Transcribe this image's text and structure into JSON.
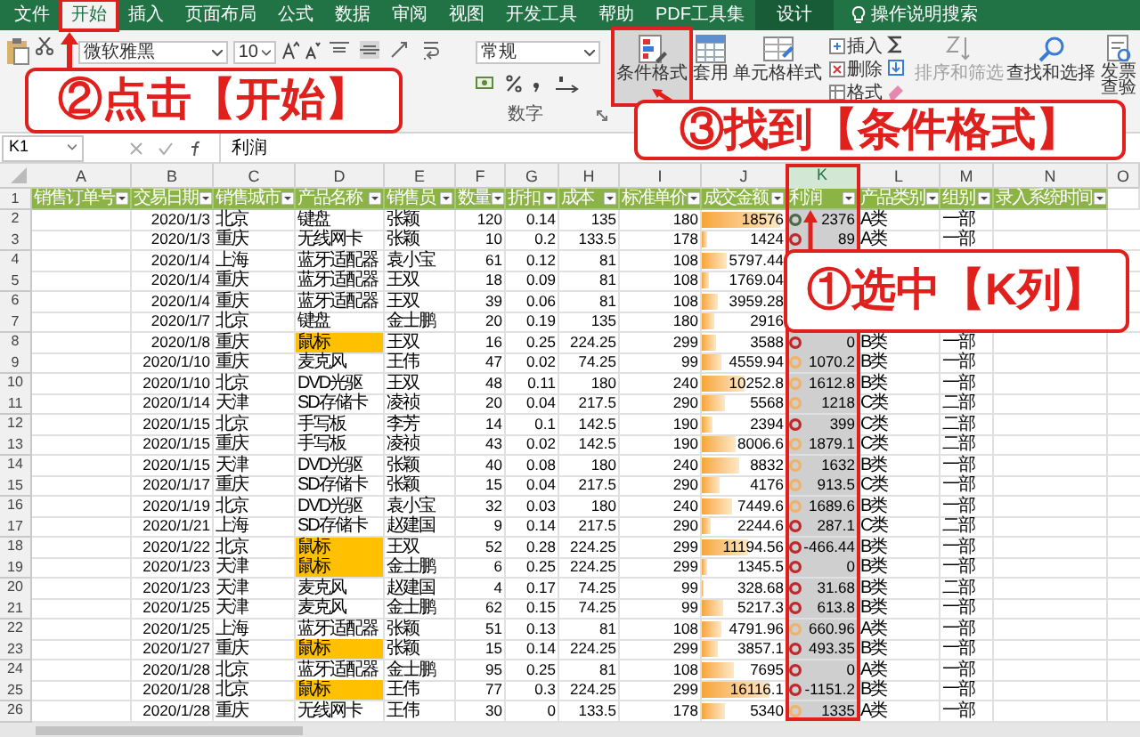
{
  "tabs": [
    {
      "label": "文件",
      "selected": false,
      "kind": "normal"
    },
    {
      "label": "开始",
      "selected": true,
      "kind": "normal"
    },
    {
      "label": "插入",
      "selected": false,
      "kind": "normal"
    },
    {
      "label": "页面布局",
      "selected": false,
      "kind": "normal"
    },
    {
      "label": "公式",
      "selected": false,
      "kind": "normal"
    },
    {
      "label": "数据",
      "selected": false,
      "kind": "normal"
    },
    {
      "label": "审阅",
      "selected": false,
      "kind": "normal"
    },
    {
      "label": "视图",
      "selected": false,
      "kind": "normal"
    },
    {
      "label": "开发工具",
      "selected": false,
      "kind": "normal"
    },
    {
      "label": "帮助",
      "selected": false,
      "kind": "normal"
    },
    {
      "label": "PDF工具集",
      "selected": false,
      "kind": "normal"
    },
    {
      "label": "设计",
      "selected": false,
      "kind": "contextual"
    }
  ],
  "search": {
    "placeholder": "操作说明搜索"
  },
  "ribbon": {
    "font_name": "微软雅黑",
    "font_size": "10",
    "number_format": "常规",
    "number_group_label": "数字",
    "styles": [
      {
        "label": "条件格式",
        "selected": true
      },
      {
        "label": "套用",
        "selected": false
      },
      {
        "label": "单元格样式",
        "selected": false
      }
    ],
    "cells": [
      "插入",
      "删除",
      "格式"
    ],
    "editing": [
      {
        "label": "排序和筛选",
        "disabled": true
      },
      {
        "label": "查找和选择",
        "disabled": false
      }
    ],
    "invoice": [
      "发票",
      "查验"
    ]
  },
  "formula_bar": {
    "name_box": "K1",
    "value": "利润"
  },
  "columns": [
    {
      "label": "A",
      "selected": false
    },
    {
      "label": "B",
      "selected": false
    },
    {
      "label": "C",
      "selected": false
    },
    {
      "label": "D",
      "selected": false
    },
    {
      "label": "E",
      "selected": false
    },
    {
      "label": "F",
      "selected": false
    },
    {
      "label": "G",
      "selected": false
    },
    {
      "label": "H",
      "selected": false
    },
    {
      "label": "I",
      "selected": false
    },
    {
      "label": "J",
      "selected": false
    },
    {
      "label": "K",
      "selected": true
    },
    {
      "label": "L",
      "selected": false
    },
    {
      "label": "M",
      "selected": false
    },
    {
      "label": "N",
      "selected": false
    },
    {
      "label": "O",
      "selected": false
    }
  ],
  "header_row_number": "1",
  "headers": [
    "销售订单号",
    "交易日期",
    "销售城市",
    "产品名称",
    "销售员",
    "数量",
    "折扣",
    "成本",
    "标准单价",
    "成交金额",
    "利润",
    "产品类别",
    "组别",
    "录入系统时间"
  ],
  "rows": [
    {
      "n": "2",
      "cells": [
        "2020/1/3",
        "北京",
        "键盘",
        "张颖",
        "120",
        "0.14",
        "135",
        "180",
        "18576",
        "2376",
        "A类",
        "一部"
      ],
      "product_highlight": false,
      "level": 0.93,
      "color": "#4a6a4a"
    },
    {
      "n": "3",
      "cells": [
        "2020/1/3",
        "重庆",
        "无线网卡",
        "张颖",
        "10",
        "0.2",
        "133.5",
        "178",
        "1424",
        "89",
        "A类",
        "一部"
      ],
      "product_highlight": false,
      "level": 0.07,
      "color": "#c0282a"
    },
    {
      "n": "4",
      "cells": [
        "2020/1/4",
        "上海",
        "蓝牙适配器",
        "袁小宝",
        "61",
        "0.12",
        "81",
        "108",
        "5797.44",
        null,
        null,
        null
      ],
      "product_highlight": false,
      "level": 0.29
    },
    {
      "n": "5",
      "cells": [
        "2020/1/4",
        "重庆",
        "蓝牙适配器",
        "王双",
        "18",
        "0.09",
        "81",
        "108",
        "1769.04",
        null,
        null,
        null
      ],
      "product_highlight": false,
      "level": 0.09
    },
    {
      "n": "6",
      "cells": [
        "2020/1/4",
        "重庆",
        "蓝牙适配器",
        "王双",
        "39",
        "0.06",
        "81",
        "108",
        "3959.28",
        null,
        null,
        null
      ],
      "product_highlight": false,
      "level": 0.2
    },
    {
      "n": "7",
      "cells": [
        "2020/1/7",
        "北京",
        "键盘",
        "金士鹏",
        "20",
        "0.19",
        "135",
        "180",
        "2916",
        null,
        null,
        null
      ],
      "product_highlight": false,
      "level": 0.15
    },
    {
      "n": "8",
      "cells": [
        "2020/1/8",
        "重庆",
        "鼠标",
        "王双",
        "16",
        "0.25",
        "224.25",
        "299",
        "3588",
        "0",
        "B类",
        "一部"
      ],
      "product_highlight": true,
      "level": 0.18,
      "color": "#c0282a"
    },
    {
      "n": "9",
      "cells": [
        "2020/1/10",
        "重庆",
        "麦克风",
        "王伟",
        "47",
        "0.02",
        "74.25",
        "99",
        "4559.94",
        "1070.2",
        "B类",
        "一部"
      ],
      "product_highlight": false,
      "level": 0.23,
      "color": "#f2b266"
    },
    {
      "n": "10",
      "cells": [
        "2020/1/10",
        "北京",
        "DVD光驱",
        "王双",
        "48",
        "0.11",
        "180",
        "240",
        "10252.8",
        "1612.8",
        "B类",
        "一部"
      ],
      "product_highlight": false,
      "level": 0.51,
      "color": "#f2b266"
    },
    {
      "n": "11",
      "cells": [
        "2020/1/14",
        "天津",
        "SD存储卡",
        "凌祯",
        "20",
        "0.04",
        "217.5",
        "290",
        "5568",
        "1218",
        "C类",
        "二部"
      ],
      "product_highlight": false,
      "level": 0.28,
      "color": "#f2b266"
    },
    {
      "n": "12",
      "cells": [
        "2020/1/15",
        "北京",
        "手写板",
        "李芳",
        "14",
        "0.1",
        "142.5",
        "190",
        "2394",
        "399",
        "C类",
        "二部"
      ],
      "product_highlight": false,
      "level": 0.12,
      "color": "#c0282a"
    },
    {
      "n": "13",
      "cells": [
        "2020/1/15",
        "重庆",
        "手写板",
        "凌祯",
        "43",
        "0.02",
        "142.5",
        "190",
        "8006.6",
        "1879.1",
        "C类",
        "二部"
      ],
      "product_highlight": false,
      "level": 0.4,
      "color": "#f2b266"
    },
    {
      "n": "14",
      "cells": [
        "2020/1/15",
        "天津",
        "DVD光驱",
        "张颖",
        "40",
        "0.08",
        "180",
        "240",
        "8832",
        "1632",
        "B类",
        "一部"
      ],
      "product_highlight": false,
      "level": 0.44,
      "color": "#f2b266"
    },
    {
      "n": "15",
      "cells": [
        "2020/1/17",
        "重庆",
        "SD存储卡",
        "张颖",
        "15",
        "0.04",
        "217.5",
        "290",
        "4176",
        "913.5",
        "C类",
        "一部"
      ],
      "product_highlight": false,
      "level": 0.21,
      "color": "#f2b266"
    },
    {
      "n": "16",
      "cells": [
        "2020/1/19",
        "北京",
        "DVD光驱",
        "袁小宝",
        "32",
        "0.03",
        "180",
        "240",
        "7449.6",
        "1689.6",
        "B类",
        "一部"
      ],
      "product_highlight": false,
      "level": 0.37,
      "color": "#f2b266"
    },
    {
      "n": "17",
      "cells": [
        "2020/1/21",
        "上海",
        "SD存储卡",
        "赵建国",
        "9",
        "0.14",
        "217.5",
        "290",
        "2244.6",
        "287.1",
        "C类",
        "二部"
      ],
      "product_highlight": false,
      "level": 0.11,
      "color": "#c0282a"
    },
    {
      "n": "18",
      "cells": [
        "2020/1/22",
        "北京",
        "鼠标",
        "王双",
        "52",
        "0.28",
        "224.25",
        "299",
        "11194.56",
        "-466.44",
        "B类",
        "一部"
      ],
      "product_highlight": true,
      "level": 0.56,
      "color": "#c0282a"
    },
    {
      "n": "19",
      "cells": [
        "2020/1/23",
        "天津",
        "鼠标",
        "金士鹏",
        "6",
        "0.25",
        "224.25",
        "299",
        "1345.5",
        "0",
        "B类",
        "一部"
      ],
      "product_highlight": true,
      "level": 0.07,
      "color": "#c0282a"
    },
    {
      "n": "20",
      "cells": [
        "2020/1/23",
        "天津",
        "麦克风",
        "赵建国",
        "4",
        "0.17",
        "74.25",
        "99",
        "328.68",
        "31.68",
        "B类",
        "二部"
      ],
      "product_highlight": false,
      "level": 0.02,
      "color": "#c0282a"
    },
    {
      "n": "21",
      "cells": [
        "2020/1/25",
        "天津",
        "麦克风",
        "金士鹏",
        "62",
        "0.15",
        "74.25",
        "99",
        "5217.3",
        "613.8",
        "B类",
        "一部"
      ],
      "product_highlight": false,
      "level": 0.26,
      "color": "#c0282a"
    },
    {
      "n": "22",
      "cells": [
        "2020/1/25",
        "上海",
        "蓝牙适配器",
        "张颖",
        "51",
        "0.13",
        "81",
        "108",
        "4791.96",
        "660.96",
        "A类",
        "一部"
      ],
      "product_highlight": false,
      "level": 0.24,
      "color": "#f2b266"
    },
    {
      "n": "23",
      "cells": [
        "2020/1/27",
        "重庆",
        "鼠标",
        "张颖",
        "15",
        "0.14",
        "224.25",
        "299",
        "3857.1",
        "493.35",
        "B类",
        "一部"
      ],
      "product_highlight": true,
      "level": 0.19,
      "color": "#c0282a"
    },
    {
      "n": "24",
      "cells": [
        "2020/1/28",
        "北京",
        "蓝牙适配器",
        "金士鹏",
        "95",
        "0.25",
        "81",
        "108",
        "7695",
        "0",
        "A类",
        "一部"
      ],
      "product_highlight": false,
      "level": 0.38,
      "color": "#c0282a"
    },
    {
      "n": "25",
      "cells": [
        "2020/1/28",
        "北京",
        "鼠标",
        "王伟",
        "77",
        "0.3",
        "224.25",
        "299",
        "16116.1",
        "-1151.2",
        "B类",
        "一部"
      ],
      "product_highlight": true,
      "level": 0.81,
      "color": "#c0282a"
    },
    {
      "n": "26",
      "cells": [
        "2020/1/28",
        "重庆",
        "无线网卡",
        "王伟",
        "30",
        "0",
        "133.5",
        "178",
        "5340",
        "1335",
        "A类",
        "一部"
      ],
      "product_highlight": false,
      "level": 0.27,
      "color": "#f2b266"
    }
  ],
  "annotations": [
    "②点击【开始】",
    "③找到【条件格式】",
    "①选中【K列】"
  ]
}
